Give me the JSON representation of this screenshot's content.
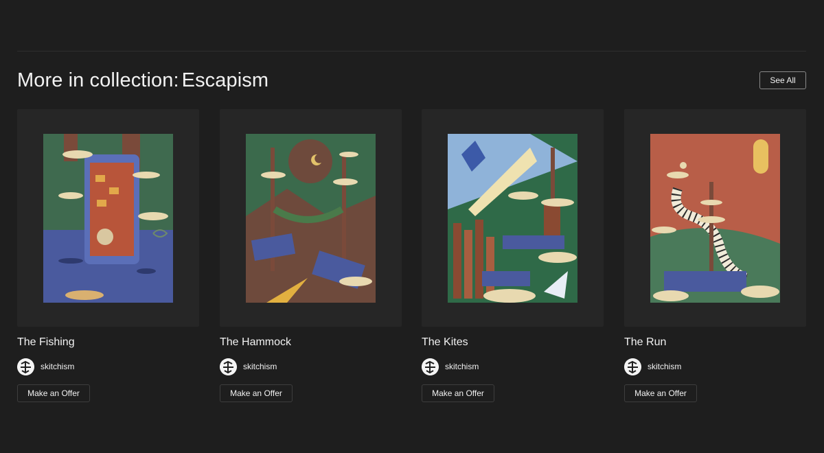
{
  "section": {
    "title_prefix": "More in collection:",
    "collection_name": "Escapism",
    "see_all_label": "See All"
  },
  "cards": [
    {
      "title": "The Fishing",
      "creator": "skitchism",
      "offer_label": "Make an Offer",
      "artwork_palette": [
        "#3f6a4f",
        "#4a5a9e",
        "#8c5a3a"
      ]
    },
    {
      "title": "The Hammock",
      "creator": "skitchism",
      "offer_label": "Make an Offer",
      "artwork_palette": [
        "#3b6a4c",
        "#6e4a3c",
        "#d9b86a"
      ]
    },
    {
      "title": "The Kites",
      "creator": "skitchism",
      "offer_label": "Make an Offer",
      "artwork_palette": [
        "#2f6a48",
        "#8fb3d9",
        "#c05a3c"
      ]
    },
    {
      "title": "The Run",
      "creator": "skitchism",
      "offer_label": "Make an Offer",
      "artwork_palette": [
        "#b85e48",
        "#4a7a5a",
        "#e8d9a8"
      ]
    }
  ],
  "colors": {
    "background": "#1e1e1e",
    "card_background": "#262626",
    "text": "#f2f2f2"
  }
}
